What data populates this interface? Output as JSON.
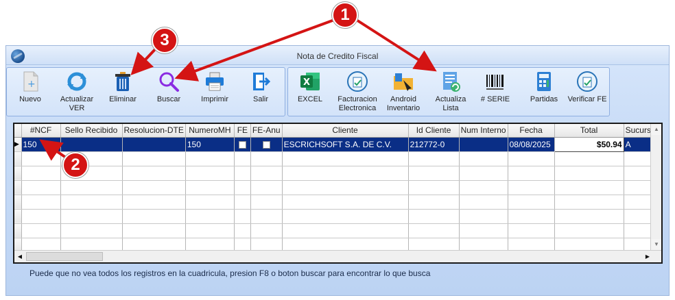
{
  "window": {
    "title": "Nota de Credito Fiscal"
  },
  "toolbar_left": [
    {
      "label": "Nuevo",
      "icon": "new-document-icon"
    },
    {
      "label": "Actualizar\nVER",
      "icon": "refresh-icon"
    },
    {
      "label": "Eliminar",
      "icon": "trash-icon"
    },
    {
      "label": "Buscar",
      "icon": "search-icon"
    },
    {
      "label": "Imprimir",
      "icon": "printer-icon"
    },
    {
      "label": "Salir",
      "icon": "exit-icon"
    }
  ],
  "toolbar_right": [
    {
      "label": "EXCEL",
      "icon": "excel-icon"
    },
    {
      "label": "Facturacion\nElectronica",
      "icon": "e-invoice-icon"
    },
    {
      "label": "Android\nInventario",
      "icon": "android-inventory-icon"
    },
    {
      "label": "Actualiza\nLista",
      "icon": "update-list-icon"
    },
    {
      "label": "# SERIE",
      "icon": "barcode-icon"
    },
    {
      "label": "Partidas",
      "icon": "calculator-icon"
    },
    {
      "label": "Verificar FE",
      "icon": "verify-e-invoice-icon"
    }
  ],
  "grid": {
    "columns": [
      "#NCF",
      "Sello Recibido",
      "Resolucion-DTE",
      "NumeroMH",
      "FE",
      "FE-Anu",
      "Cliente",
      "Id Cliente",
      "Num Interno",
      "Fecha",
      "Total",
      "Sucursa"
    ],
    "rows": [
      {
        "ncf": "150",
        "sello": "",
        "resolucion": "",
        "numero_mh": "150",
        "fe": false,
        "fe_anu": false,
        "cliente": "ESCRICHSOFT S.A. DE C.V.",
        "id_cliente": "212772-0",
        "num_interno": "",
        "fecha": "08/08/2025",
        "total": "$50.94",
        "sucursal": "A"
      }
    ]
  },
  "footer": {
    "note": "Puede que no vea todos los registros en la cuadricula, presion F8 o boton buscar para encontrar lo que busca"
  },
  "annotations": {
    "badge1": "1",
    "badge2": "2",
    "badge3": "3"
  },
  "colors": {
    "accent": "#0a2e86",
    "annotation": "#d41414"
  }
}
